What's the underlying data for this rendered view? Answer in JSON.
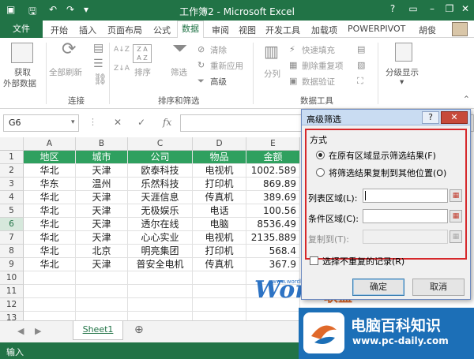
{
  "window": {
    "title": "工作簿2 - Microsoft Excel",
    "help": "?",
    "minimize": "–",
    "restore": "❐",
    "close": "✕"
  },
  "tabs": {
    "file": "文件",
    "items": [
      "开始",
      "插入",
      "页面布局",
      "公式",
      "数据",
      "审阅",
      "视图",
      "开发工具",
      "加载项",
      "POWERPIVOT"
    ],
    "active_index": 4,
    "user": "胡俊"
  },
  "ribbon": {
    "get_external": "获取\n外部数据",
    "get_external_line1": "获取",
    "get_external_line2": "外部数据",
    "refresh_all": "全部刷新",
    "group_connections": "连接",
    "sort": "排序",
    "filter": "筛选",
    "clear": "清除",
    "reapply": "重新应用",
    "advanced": "高级",
    "group_sort_filter": "排序和筛选",
    "split": "分列",
    "flash_fill": "快速填充",
    "remove_dup": "删除重复项",
    "validation": "数据验证",
    "group_data_tools": "数据工具",
    "outline": "分级显示",
    "sort_az": "A↓Z",
    "sort_za": "Z↓A"
  },
  "formula_bar": {
    "name_box": "G6",
    "fx": "fx",
    "cancel": "✕",
    "enter": "✓"
  },
  "sheet": {
    "columns": [
      "A",
      "B",
      "C",
      "D",
      "E"
    ],
    "rows": [
      "1",
      "2",
      "3",
      "4",
      "5",
      "6",
      "7",
      "8",
      "9",
      "10",
      "11",
      "12",
      "13"
    ],
    "selected_row": 6,
    "header": [
      "地区",
      "城市",
      "公司",
      "物品",
      "金额"
    ],
    "data": [
      [
        "华北",
        "天津",
        "欧泰科技",
        "电视机",
        "1002.589"
      ],
      [
        "华东",
        "温州",
        "乐然科技",
        "打印机",
        "869.89"
      ],
      [
        "华北",
        "天津",
        "天涯信息",
        "传真机",
        "389.69"
      ],
      [
        "华北",
        "天津",
        "无极娱乐",
        "电话",
        "100.56"
      ],
      [
        "华北",
        "天津",
        "透尔在线",
        "电脑",
        "8536.49"
      ],
      [
        "华北",
        "天津",
        "心心实业",
        "电视机",
        "2135.889"
      ],
      [
        "华北",
        "北京",
        "明亮集团",
        "打印机",
        "568.4"
      ],
      [
        "华北",
        "天津",
        "普安全电机",
        "传真机",
        "367.9"
      ]
    ]
  },
  "sheet_tabs": {
    "active": "Sheet1"
  },
  "status": {
    "mode": "输入"
  },
  "dialog": {
    "title": "高级筛选",
    "help": "?",
    "close": "✕",
    "method_label": "方式",
    "option_inplace": "在原有区域显示筛选结果(F)",
    "option_copy": "将筛选结果复制到其他位置(O)",
    "list_range_label": "列表区域(L):",
    "criteria_range_label": "条件区域(C):",
    "copy_to_label": "复制到(T):",
    "list_range_value": "",
    "criteria_range_value": "",
    "copy_to_value": "",
    "unique_label": "选择不重复的记录(R)",
    "ok": "确定",
    "cancel": "取消"
  },
  "watermark": {
    "word": "Word",
    "union": "联盟",
    "word_url": "www.wordlm.com",
    "site_name": "电脑百科知识",
    "site_url": "www.pc-daily.com"
  },
  "colors": {
    "excel_green": "#217346",
    "header_fill": "#2fa05f",
    "highlight_red": "#d6282b",
    "logo_blue": "#1c6fb7"
  }
}
